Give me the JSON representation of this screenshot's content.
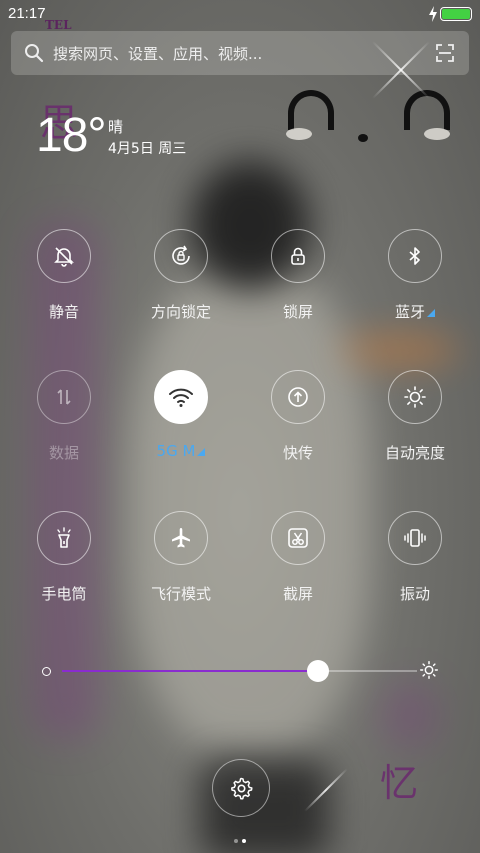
{
  "status_bar": {
    "time": "21:17",
    "battery_color": "#43d143"
  },
  "search": {
    "placeholder": "搜索网页、设置、应用、视频..."
  },
  "weather": {
    "temperature": "18°",
    "condition": "晴",
    "date": "4月5日 周三"
  },
  "wallpaper": {
    "text_top": "TEL",
    "text_left": "思",
    "text_bottom": "忆"
  },
  "toggles": [
    {
      "label": "静音",
      "icon": "bell-slash-icon",
      "state": "normal"
    },
    {
      "label": "方向锁定",
      "icon": "rotation-lock-icon",
      "state": "normal"
    },
    {
      "label": "锁屏",
      "icon": "lock-icon",
      "state": "normal"
    },
    {
      "label": "蓝牙",
      "icon": "bluetooth-icon",
      "state": "normal",
      "has_more": true
    },
    {
      "label": "数据",
      "icon": "mobile-data-icon",
      "state": "disabled"
    },
    {
      "label": "5G M",
      "icon": "wifi-icon",
      "state": "active",
      "has_more": true
    },
    {
      "label": "快传",
      "icon": "upload-icon",
      "state": "normal"
    },
    {
      "label": "自动亮度",
      "icon": "sun-icon",
      "state": "normal"
    },
    {
      "label": "手电筒",
      "icon": "flashlight-icon",
      "state": "normal"
    },
    {
      "label": "飞行模式",
      "icon": "airplane-icon",
      "state": "normal"
    },
    {
      "label": "截屏",
      "icon": "scissors-icon",
      "state": "normal"
    },
    {
      "label": "振动",
      "icon": "vibrate-icon",
      "state": "normal"
    }
  ],
  "brightness": {
    "level": 0.72,
    "fill_color": "#8a2ccf"
  },
  "settings": {
    "icon": "gear-icon"
  },
  "pager": {
    "pages": 2,
    "active": 1
  },
  "colors": {
    "accent": "#4aa8f0"
  }
}
